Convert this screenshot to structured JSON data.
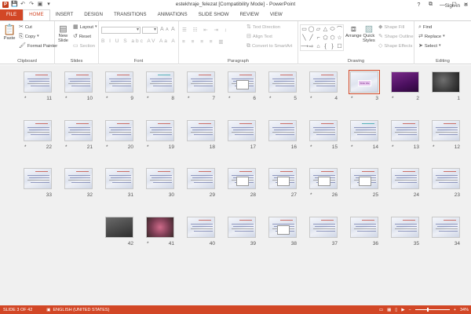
{
  "window": {
    "title": "estekhraje_felezat [Compatibility Mode] - PowerPoint",
    "controls": {
      "help": "?",
      "restore": "⧉",
      "minimize": "—",
      "maximize": "☐",
      "close": "✕"
    }
  },
  "qat": {
    "logo": "P",
    "save": "💾",
    "undo": "↶",
    "redo": "↷",
    "present": "▣",
    "customize": "▾"
  },
  "tabs": [
    "FILE",
    "HOME",
    "INSERT",
    "DESIGN",
    "TRANSITIONS",
    "ANIMATIONS",
    "SLIDE SHOW",
    "REVIEW",
    "VIEW"
  ],
  "active_tab": "HOME",
  "account": {
    "signin": "Sign in",
    "smiley": "☺"
  },
  "ribbon": {
    "clipboard": {
      "label": "Clipboard",
      "paste": "Paste",
      "cut": "Cut",
      "copy": "Copy",
      "format_painter": "Format Painter"
    },
    "slides": {
      "label": "Slides",
      "new_slide": "New",
      "new_slide2": "Slide",
      "layout": "Layout",
      "reset": "Reset",
      "section": "Section"
    },
    "font": {
      "label": "Font",
      "size_up": "A",
      "size_down": "A",
      "clear": "A",
      "styles": "B I U S abc AV Aa A"
    },
    "paragraph": {
      "label": "Paragraph",
      "text_direction": "Text Direction",
      "align_text": "Align Text",
      "convert_smartart": "Convert to SmartArt"
    },
    "drawing": {
      "label": "Drawing",
      "arrange": "Arrange",
      "quick_styles": "Quick",
      "quick_styles2": "Styles",
      "shape_fill": "Shape Fill",
      "shape_outline": "Shape Outline",
      "shape_effects": "Shape Effects"
    },
    "editing": {
      "label": "Editing",
      "find": "Find",
      "replace": "Replace",
      "select": "Select"
    },
    "shape_glyphs": [
      "▭",
      "◯",
      "▱",
      "△",
      "⬭",
      "⌒",
      "╲",
      "╱",
      "⌐",
      "⬠",
      "⬡",
      "☆",
      "⟶",
      "⇨",
      "⌂",
      "{",
      "}",
      "☐"
    ]
  },
  "slides": [
    {
      "n": "1",
      "star": false,
      "kind": "photo"
    },
    {
      "n": "2",
      "star": true,
      "kind": "purple"
    },
    {
      "n": "3",
      "star": true,
      "kind": "title-purple",
      "selected": true,
      "title_text": "Slide title"
    },
    {
      "n": "4",
      "star": true,
      "kind": "text"
    },
    {
      "n": "5",
      "star": true,
      "kind": "text"
    },
    {
      "n": "6",
      "star": true,
      "kind": "diagram"
    },
    {
      "n": "7",
      "star": true,
      "kind": "text"
    },
    {
      "n": "8",
      "star": true,
      "kind": "text-teal"
    },
    {
      "n": "9",
      "star": true,
      "kind": "text"
    },
    {
      "n": "10",
      "star": true,
      "kind": "text"
    },
    {
      "n": "11",
      "star": true,
      "kind": "text"
    },
    {
      "n": "12",
      "star": true,
      "kind": "text"
    },
    {
      "n": "13",
      "star": true,
      "kind": "text"
    },
    {
      "n": "14",
      "star": true,
      "kind": "text-teal"
    },
    {
      "n": "15",
      "star": true,
      "kind": "text"
    },
    {
      "n": "16",
      "star": false,
      "kind": "text"
    },
    {
      "n": "17",
      "star": false,
      "kind": "text"
    },
    {
      "n": "18",
      "star": false,
      "kind": "text"
    },
    {
      "n": "19",
      "star": true,
      "kind": "text"
    },
    {
      "n": "20",
      "star": true,
      "kind": "text"
    },
    {
      "n": "21",
      "star": true,
      "kind": "text"
    },
    {
      "n": "22",
      "star": true,
      "kind": "text"
    },
    {
      "n": "23",
      "star": false,
      "kind": "text"
    },
    {
      "n": "24",
      "star": false,
      "kind": "text"
    },
    {
      "n": "25",
      "star": false,
      "kind": "diagram"
    },
    {
      "n": "26",
      "star": true,
      "kind": "diagram"
    },
    {
      "n": "27",
      "star": false,
      "kind": "diagram"
    },
    {
      "n": "28",
      "star": false,
      "kind": "diagram"
    },
    {
      "n": "29",
      "star": false,
      "kind": "text"
    },
    {
      "n": "30",
      "star": false,
      "kind": "text"
    },
    {
      "n": "31",
      "star": false,
      "kind": "text"
    },
    {
      "n": "32",
      "star": false,
      "kind": "text"
    },
    {
      "n": "33",
      "star": false,
      "kind": "text"
    },
    {
      "n": "34",
      "star": false,
      "kind": "text"
    },
    {
      "n": "35",
      "star": false,
      "kind": "text"
    },
    {
      "n": "36",
      "star": false,
      "kind": "text"
    },
    {
      "n": "37",
      "star": false,
      "kind": "text"
    },
    {
      "n": "38",
      "star": false,
      "kind": "diagram"
    },
    {
      "n": "39",
      "star": false,
      "kind": "text"
    },
    {
      "n": "40",
      "star": false,
      "kind": "text"
    },
    {
      "n": "41",
      "star": true,
      "kind": "pinkphoto"
    },
    {
      "n": "42",
      "star": false,
      "kind": "laptop"
    }
  ],
  "status": {
    "slide_counter": "SLIDE 3 OF 42",
    "language": "ENGLISH (UNITED STATES)",
    "zoom": "34%",
    "zoom_level": 0.34,
    "minus": "−",
    "plus": "+"
  },
  "colors": {
    "accent": "#d24726",
    "selected_outline": "#d24726",
    "sorter_bg": "#f0f0f0"
  }
}
